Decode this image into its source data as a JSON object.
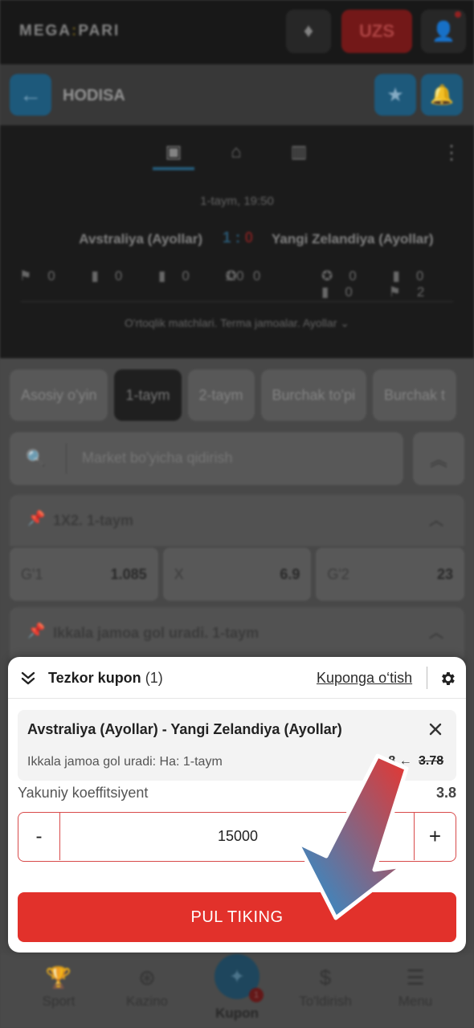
{
  "topbar": {
    "logo_left": "MEGA",
    "logo_dot": ":",
    "logo_right": "PARI",
    "currency": "UZS"
  },
  "header": {
    "title": "HODISA"
  },
  "match": {
    "period_time": "1-taym, 19:50",
    "team1": "Avstraliya (Ayollar)",
    "team2": "Yangi Zelandiya (Ayollar)",
    "score1": "1",
    "score_sep": ":",
    "score2": "0",
    "stats_left": [
      "0",
      "0",
      "0",
      "0"
    ],
    "stats_mid": "1:0",
    "stats_right": [
      "0",
      "0",
      "0",
      "2"
    ],
    "info": "O'rtoqlik matchlari. Terma jamoalar. Ayollar"
  },
  "period_tabs": [
    "Asosiy o'yin",
    "1-taym",
    "2-taym",
    "Burchak to'pi",
    "Burchak t"
  ],
  "search": {
    "placeholder": "Market bo'yicha qidirish"
  },
  "markets": [
    {
      "title": "1X2. 1-taym",
      "odds": [
        {
          "label": "G'1",
          "value": "1.085"
        },
        {
          "label": "X",
          "value": "6.9"
        },
        {
          "label": "G'2",
          "value": "23"
        }
      ]
    },
    {
      "title": "Ikkala jamoa gol uradi. 1-taym"
    }
  ],
  "coupon": {
    "title": "Tezkor kupon",
    "count": "(1)",
    "link": "Kuponga o‘tish",
    "bet_title": "Avstraliya (Ayollar) - Yangi Zelandiya (Ayollar)",
    "bet_sub": "Ikkala jamoa gol uradi: Ha: 1-taym",
    "odd_new": "3.8",
    "odd_arrow": "←",
    "odd_old": "3.78",
    "final_label": "Yakuniy koeffitsiyent",
    "final_value": "3.8",
    "minus": "-",
    "stake": "15000",
    "plus": "+",
    "place_label": "PUL TIKING"
  },
  "bottom_nav": [
    {
      "label": "Sport",
      "icon": "trophy-icon"
    },
    {
      "label": "Kazino",
      "icon": "chip-icon"
    },
    {
      "label": "Kupon",
      "icon": "coupon-icon",
      "badge": "1"
    },
    {
      "label": "To'ldirish",
      "icon": "dollar-icon"
    },
    {
      "label": "Menu",
      "icon": "menu-icon"
    }
  ],
  "colors": {
    "accent_red": "#e2312b",
    "brand_blue": "#1f8fd6",
    "stake_border": "#d84a4a"
  }
}
